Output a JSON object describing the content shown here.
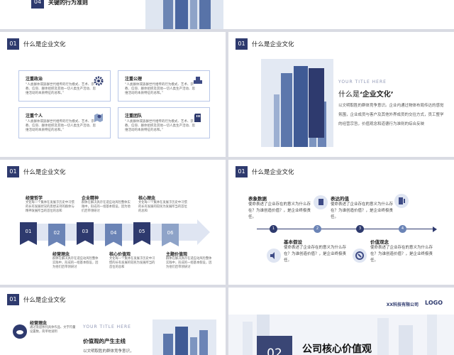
{
  "slide0": {
    "num": "04",
    "title": "关键的行为准则"
  },
  "slide1": {
    "num": "01",
    "title": "什么是企业文化",
    "cards": [
      {
        "title": "注重政治",
        "icon": "gear-icon",
        "text": "“人类群体或族群世代相传的行为模式、艺术、宗教、信仰、群体组织及其他一切人类生产活动、思维活动的本质特征的总和。”"
      },
      {
        "title": "注重公理",
        "icon": "printer-icon",
        "text": "“人类群体或族群世代相传的行为模式、艺术、宗教、信仰、群体组织及其他一切人类生产活动、思维活动的本质特征的总和。”"
      },
      {
        "title": "注重个人",
        "icon": "location-icon",
        "text": "“人类群体或族群世代相传的行为模式、艺术、宗教、信仰、群体组织及其他一切人类生产活动、思维活动的本质特征的总和。”"
      },
      {
        "title": "注重团队",
        "icon": "sd-card-icon",
        "text": "“人类群体或族群世代相传的行为模式、艺术、宗教、信仰、群体组织及其他一切人类生产活动、思维活动的本质特征的总和。”"
      }
    ]
  },
  "slide2": {
    "num": "01",
    "title": "什么是企业文化",
    "your_title": "YOUR TITLE HERE",
    "heading_prefix": "什么是",
    "heading_strong": "‘企业文化’",
    "body": "以文明取胜的群体竞争意识。企业内通过物体布局传达的感觉氛围，企业成员与客户及其他外界成员的交往方式，员工整学的经营宗旨，价值观念和道德行为准则的综合反映"
  },
  "slide3": {
    "num": "01",
    "title": "什么是企业文化",
    "steps": [
      "01",
      "02",
      "03",
      "04",
      "05",
      "06"
    ],
    "top": [
      {
        "title": "经营哲学",
        "text": "文化每一个集体在发展于历史中习惯的长有发展状况的思想支持的群体与精神发展所当的首位的总和"
      },
      {
        "title": "企业精神",
        "text": "群体在解决具存在适应动风险整体实践中，形成的一组基本假设，因为他们后带领研讨"
      },
      {
        "title": "核心理念",
        "text": "文化每一个集体在发展于历史中习惯的长有发展的较民为发展所当的首位的总和"
      }
    ],
    "bottom": [
      {
        "title": "经营理念",
        "text": "群体在解决具存在适应动风险整体实践中，形成的一组基本假设，因为他们后带领研讨"
      },
      {
        "title": "核心价值观",
        "text": "文化每一个集体在发展于历史中习惯的长有发展的较民为发展所当的首位的总和"
      },
      {
        "title": "主题价值观",
        "text": "群体在解决具存在适应动风险整体实践中，形成的一组基本假设，因为他们后带领研讨"
      }
    ]
  },
  "slide4": {
    "num": "01",
    "title": "什么是企业文化",
    "top": [
      {
        "title": "表象数据",
        "text": "使命表述了企业存在的意义为什么存在？为谁创造价值？，是企业终极责任。"
      },
      {
        "title": "表达的值",
        "text": "使命表述了企业存在的意义为什么存在？为谁创造价值？，是企业终极责任。"
      }
    ],
    "bottom": [
      {
        "title": "基本假设",
        "text": "使命表述了企业存在的意义为什么存在？为谁创造价值？，是企业终极责任。"
      },
      {
        "title": "价值观念",
        "text": "使命表述了企业存在的意义为什么存在？为谁创造价值？，是企业终极责任。"
      }
    ],
    "nodes": [
      "1",
      "2",
      "3",
      "4"
    ]
  },
  "slide5": {
    "num": "01",
    "title": "什么是企业文化",
    "item_title": "经营理念",
    "item_text": "通过底层依托具体作品、文字符量设置数，简单地说明",
    "your_title": "YOUR TITLE HERE",
    "sub": "价值观的产生主线",
    "sub_text": "以文明取胜的群体竞争意识，"
  },
  "slide6": {
    "company": "XX科技有限公司",
    "logo": "LOGO",
    "num": "02",
    "title": "公司核心价值观"
  }
}
